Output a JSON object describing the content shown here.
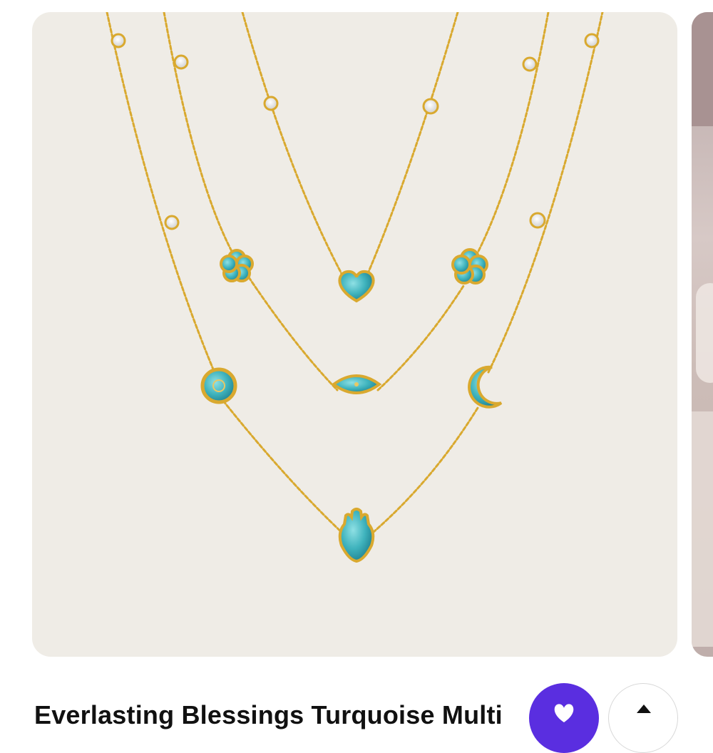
{
  "product": {
    "title": "Everlasting Blessings Turquoise Multi",
    "image_icon": "layered-turquoise-necklace-image"
  },
  "actions": {
    "favorite_icon": "heart-icon",
    "share_icon": "share-icon"
  },
  "colors": {
    "card_background": "#efece6",
    "gold": "#d9a92f",
    "turquoise": "#3fb3bd",
    "accent": "#5a2ee0"
  }
}
